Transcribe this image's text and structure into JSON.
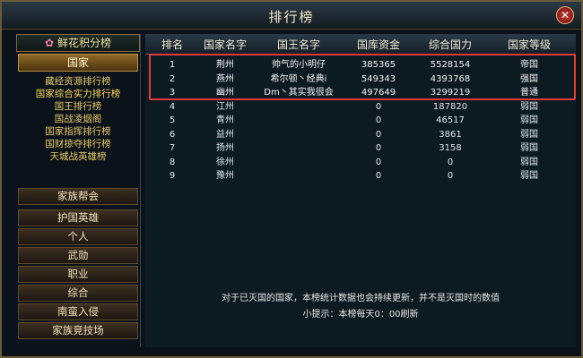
{
  "window": {
    "title": "排行榜"
  },
  "sidebar": {
    "flower_label": "鲜花积分榜",
    "country_label": "国家",
    "submenu": [
      "藏经资源排行榜",
      "国家综合实力排行榜",
      "国王排行榜",
      "国战凌烟阁",
      "国家指挥排行榜",
      "国财掠夺排行榜",
      "天城战英雄榜"
    ],
    "buttons": [
      "家族帮会",
      "护国英雄",
      "个人",
      "武勋",
      "职业",
      "综合",
      "南蛮入侵",
      "家族竞技场"
    ]
  },
  "table": {
    "headers": [
      "排名",
      "国家名字",
      "国王名字",
      "国库资金",
      "综合国力",
      "国家等级"
    ],
    "rows": [
      [
        "1",
        "荆州",
        "帅气的小明仔",
        "385365",
        "5528154",
        "帝国"
      ],
      [
        "2",
        "燕州",
        "希尔顿丶经典i",
        "549343",
        "4393768",
        "强国"
      ],
      [
        "3",
        "幽州",
        "Dm丶其实我很会",
        "497649",
        "3299219",
        "普通"
      ],
      [
        "4",
        "江州",
        "",
        "0",
        "187820",
        "弱国"
      ],
      [
        "5",
        "青州",
        "",
        "0",
        "46517",
        "弱国"
      ],
      [
        "6",
        "益州",
        "",
        "0",
        "3861",
        "弱国"
      ],
      [
        "7",
        "扬州",
        "",
        "0",
        "3158",
        "弱国"
      ],
      [
        "8",
        "徐州",
        "",
        "0",
        "0",
        "弱国"
      ],
      [
        "9",
        "豫州",
        "",
        "0",
        "0",
        "弱国"
      ]
    ]
  },
  "footer": {
    "note": "对于已灭国的国家，本榜统计数据也会持续更新，并不是灭国时的数值",
    "tip": "小提示：本榜每天0：00刷新"
  }
}
